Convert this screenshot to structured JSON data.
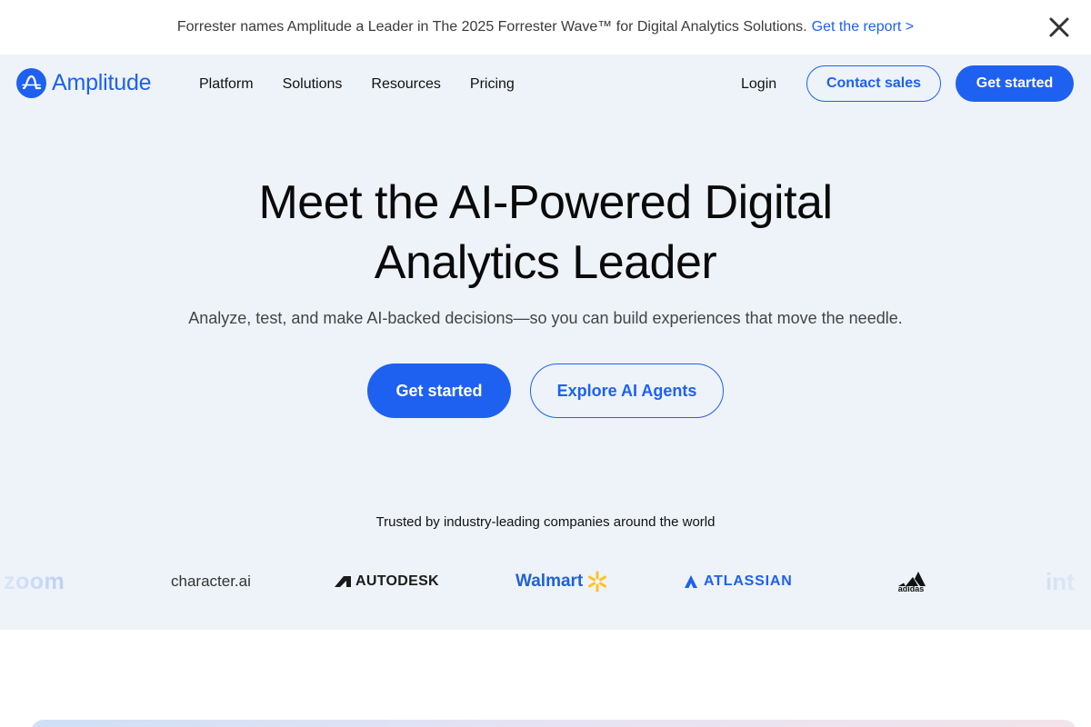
{
  "announcement": {
    "text": "Forrester names Amplitude a Leader in The 2025 Forrester Wave™ for Digital Analytics Solutions.",
    "link_label": "Get the report >",
    "close_icon": "close-icon"
  },
  "nav": {
    "logo_text": "Amplitude",
    "links": [
      "Platform",
      "Solutions",
      "Resources",
      "Pricing"
    ],
    "login": "Login",
    "contact_sales": "Contact sales",
    "get_started": "Get started"
  },
  "hero": {
    "title_line1": "Meet the AI-Powered Digital",
    "title_line2": "Analytics Leader",
    "subtitle": "Analyze, test, and make AI-backed decisions—so you can build experiences that move the needle.",
    "primary_cta": "Get started",
    "secondary_cta": "Explore AI Agents"
  },
  "trusted": {
    "heading": "Trusted by industry-leading companies around the world",
    "logos": [
      "zoom",
      "character.ai",
      "AUTODESK",
      "Walmart",
      "ATLASSIAN",
      "adidas",
      "int"
    ]
  },
  "colors": {
    "brand_blue": "#1e61f0",
    "hero_background": "#eef3f9"
  }
}
